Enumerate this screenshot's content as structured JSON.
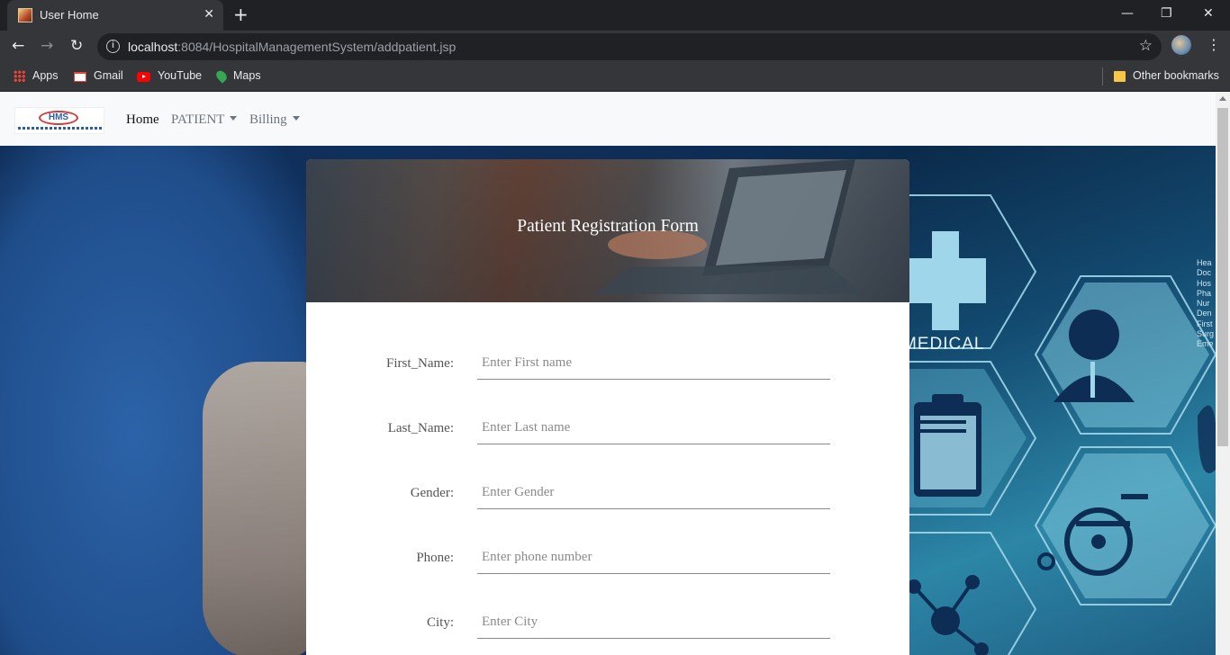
{
  "browser": {
    "tab_title": "User Home",
    "tab_close": "✕",
    "new_tab": "+",
    "url_host": "localhost",
    "url_rest": ":8084/HospitalManagementSystem/addpatient.jsp",
    "info_glyph": "i",
    "window_controls": {
      "minimize": "—",
      "restore": "❐",
      "close": "✕"
    },
    "nav": {
      "back": "←",
      "forward": "→",
      "reload": "↻"
    },
    "star": "☆",
    "menu": "⋮",
    "bookmarks": [
      {
        "label": "Apps",
        "icon": "apps-icon"
      },
      {
        "label": "Gmail",
        "icon": "gmail-icon"
      },
      {
        "label": "YouTube",
        "icon": "youtube-icon"
      },
      {
        "label": "Maps",
        "icon": "maps-icon"
      }
    ],
    "other_bookmarks": "Other bookmarks"
  },
  "site": {
    "logo_text": "HMS",
    "nav": {
      "home": "Home",
      "patient": "PATIENT",
      "billing": "Billing"
    }
  },
  "form": {
    "title": "Patient Registration Form",
    "fields": [
      {
        "label": "First_Name:",
        "placeholder": "Enter First name",
        "value": ""
      },
      {
        "label": "Last_Name:",
        "placeholder": "Enter Last name",
        "value": ""
      },
      {
        "label": "Gender:",
        "placeholder": "Enter Gender",
        "value": ""
      },
      {
        "label": "Phone:",
        "placeholder": "Enter phone number",
        "value": ""
      },
      {
        "label": "City:",
        "placeholder": "Enter City",
        "value": ""
      }
    ]
  },
  "background": {
    "medical_word": "MEDICAL",
    "side_list": [
      "Hea",
      "Doc",
      "Hos",
      "Pha",
      "Nur",
      "Den",
      "First",
      "Surg",
      "Eme"
    ]
  }
}
